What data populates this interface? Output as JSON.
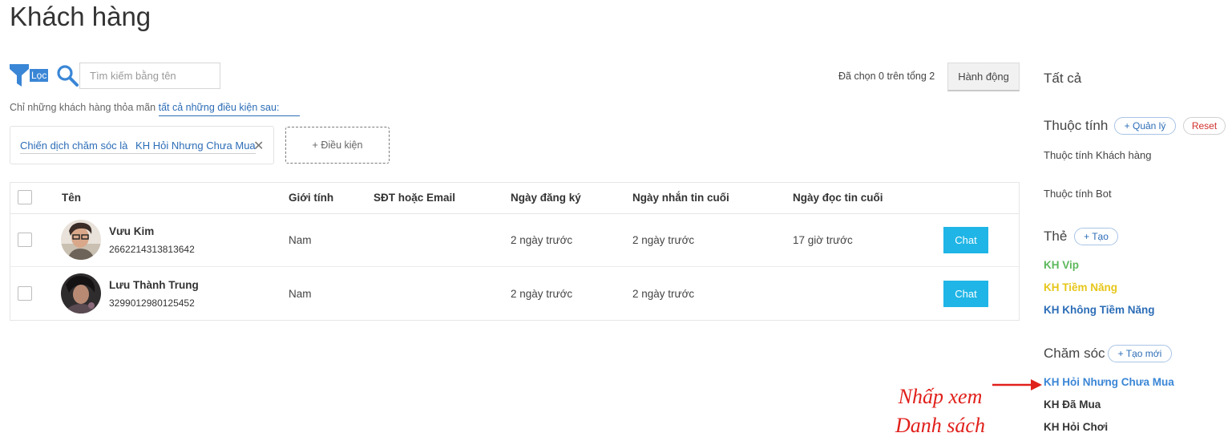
{
  "page": {
    "title": "Khách hàng"
  },
  "toolbar": {
    "filter_label": "Lọc",
    "search_placeholder": "Tìm kiếm bằng tên",
    "selected_count": "Đã chọn 0 trên tổng 2",
    "action_label": "Hành động"
  },
  "filter": {
    "description_prefix": "Chỉ những khách hàng thỏa mãn",
    "description_link": "tất cả những điều kiện sau:",
    "condition_field": "Chiến dịch chăm sóc là",
    "condition_value": "KH Hỏi Nhưng Chưa Mua",
    "add_condition_label": "+ Điều kiện"
  },
  "table": {
    "columns": [
      "Tên",
      "Giới tính",
      "SĐT hoặc Email",
      "Ngày đăng ký",
      "Ngày nhắn tin cuối",
      "Ngày đọc tin cuối"
    ],
    "rows": [
      {
        "name": "Vưu Kim",
        "id": "2662214313813642",
        "gender": "Nam",
        "contact": "",
        "registered": "2 ngày trước",
        "last_message": "2 ngày trước",
        "last_read": "17 giờ trước",
        "chat_label": "Chat"
      },
      {
        "name": "Lưu Thành Trung",
        "id": "3299012980125452",
        "gender": "Nam",
        "contact": "",
        "registered": "2 ngày trước",
        "last_message": "2 ngày trước",
        "last_read": "",
        "chat_label": "Chat"
      }
    ]
  },
  "sidebar": {
    "all_label": "Tất cả",
    "attributes": {
      "title": "Thuộc tính",
      "manage_label": "+ Quản lý",
      "reset_label": "Reset",
      "items": [
        "Thuộc tính Khách hàng",
        "Thuộc tính Bot"
      ]
    },
    "tags": {
      "title": "Thẻ",
      "create_label": "+ Tạo",
      "items": [
        {
          "label": "KH Vip",
          "color": "#5cb85c"
        },
        {
          "label": "KH Tiềm Năng",
          "color": "#e6c619"
        },
        {
          "label": "KH Không Tiềm Năng",
          "color": "#2c6db7"
        }
      ]
    },
    "care": {
      "title": "Chăm sóc",
      "create_label": "+ Tạo mới",
      "items": [
        {
          "label": "KH Hỏi Nhưng Chưa Mua",
          "color": "#3a86d6"
        },
        {
          "label": "KH Đã Mua",
          "color": "#333333"
        },
        {
          "label": "KH Hỏi Chơi",
          "color": "#333333"
        }
      ]
    }
  },
  "annotation": {
    "line1": "Nhấp xem",
    "line2": "Danh sách",
    "color": "#e0201b"
  }
}
